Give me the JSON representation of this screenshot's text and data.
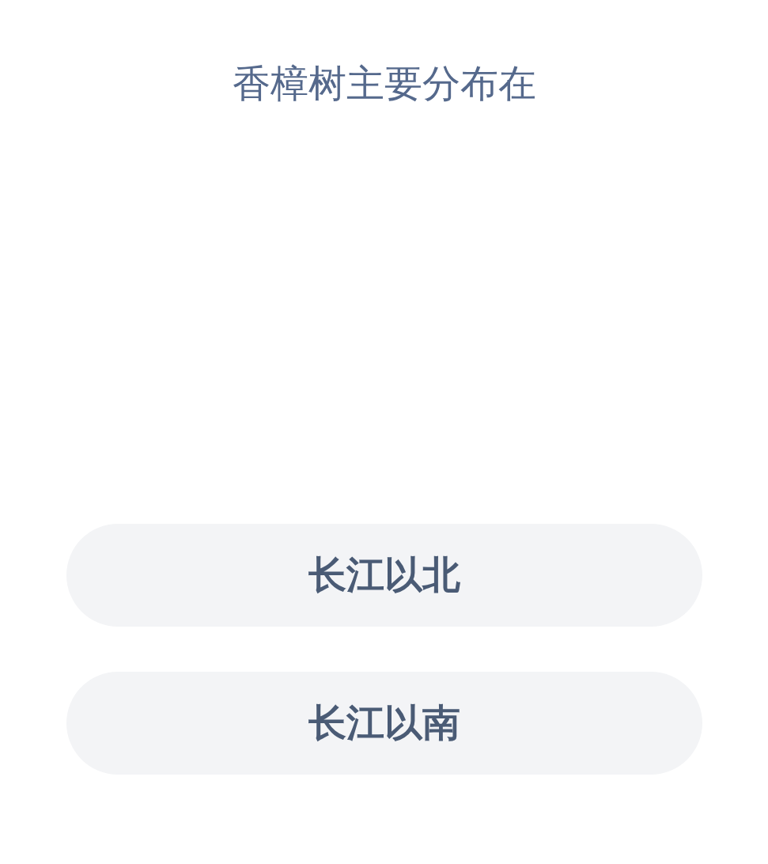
{
  "question": "香樟树主要分布在",
  "options": [
    {
      "label": "长江以北"
    },
    {
      "label": "长江以南"
    }
  ]
}
